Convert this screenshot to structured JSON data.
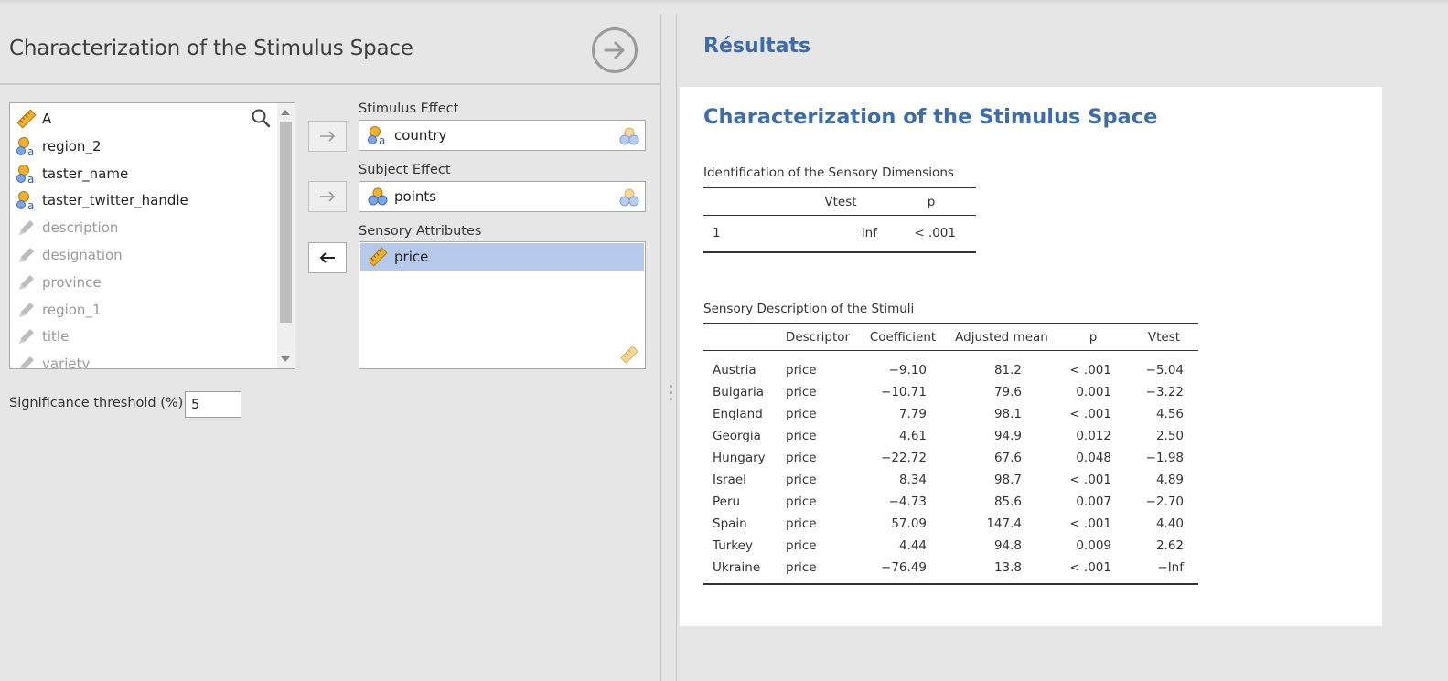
{
  "options": {
    "title": "Characterization of the Stimulus Space",
    "variables": [
      {
        "name": "A",
        "type": "continuous",
        "enabled": true
      },
      {
        "name": "region_2",
        "type": "nominal-text",
        "enabled": true
      },
      {
        "name": "taster_name",
        "type": "nominal-text",
        "enabled": true
      },
      {
        "name": "taster_twitter_handle",
        "type": "nominal-text",
        "enabled": true
      },
      {
        "name": "description",
        "type": "text",
        "enabled": false
      },
      {
        "name": "designation",
        "type": "text",
        "enabled": false
      },
      {
        "name": "province",
        "type": "text",
        "enabled": false
      },
      {
        "name": "region_1",
        "type": "text",
        "enabled": false
      },
      {
        "name": "title",
        "type": "text",
        "enabled": false
      },
      {
        "name": "variety",
        "type": "text",
        "enabled": false
      }
    ],
    "stimulus_effect": {
      "label": "Stimulus Effect",
      "value": "country"
    },
    "subject_effect": {
      "label": "Subject Effect",
      "value": "points"
    },
    "sensory_attributes": {
      "label": "Sensory Attributes",
      "items": [
        "price"
      ]
    },
    "significance": {
      "label": "Significance threshold (%)",
      "value": "5"
    }
  },
  "results": {
    "heading": "Résultats",
    "analysis_title": "Characterization of the Stimulus Space",
    "dimensions": {
      "caption": "Identification of the Sensory Dimensions",
      "headers": [
        "",
        "Vtest",
        "p"
      ],
      "rows": [
        [
          "1",
          "Inf",
          "< .001"
        ]
      ]
    },
    "description": {
      "caption": "Sensory Description of the Stimuli",
      "headers": [
        "",
        "Descriptor",
        "Coefficient",
        "Adjusted mean",
        "p",
        "Vtest"
      ],
      "rows": [
        [
          "Austria",
          "price",
          "−9.10",
          "81.2",
          "< .001",
          "−5.04"
        ],
        [
          "Bulgaria",
          "price",
          "−10.71",
          "79.6",
          "0.001",
          "−3.22"
        ],
        [
          "England",
          "price",
          "7.79",
          "98.1",
          "< .001",
          "4.56"
        ],
        [
          "Georgia",
          "price",
          "4.61",
          "94.9",
          "0.012",
          "2.50"
        ],
        [
          "Hungary",
          "price",
          "−22.72",
          "67.6",
          "0.048",
          "−1.98"
        ],
        [
          "Israel",
          "price",
          "8.34",
          "98.7",
          "< .001",
          "4.89"
        ],
        [
          "Peru",
          "price",
          "−4.73",
          "85.6",
          "0.007",
          "−2.70"
        ],
        [
          "Spain",
          "price",
          "57.09",
          "147.4",
          "< .001",
          "4.40"
        ],
        [
          "Turkey",
          "price",
          "4.44",
          "94.8",
          "0.009",
          "2.62"
        ],
        [
          "Ukraine",
          "price",
          "−76.49",
          "13.8",
          "< .001",
          "−Inf"
        ]
      ]
    }
  }
}
